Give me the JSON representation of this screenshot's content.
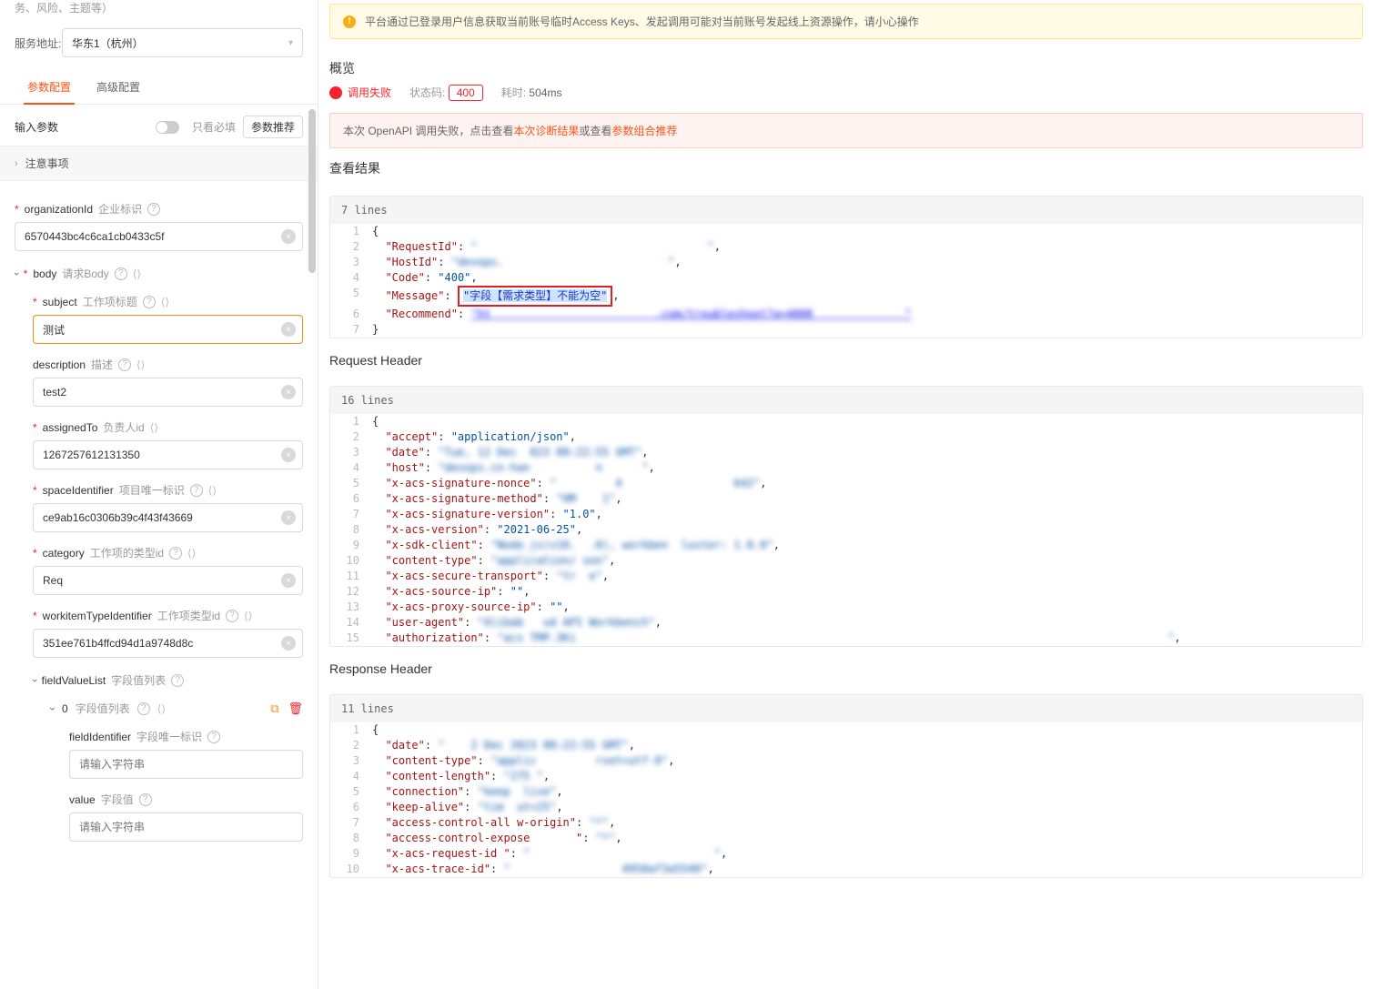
{
  "sidebar": {
    "topNote": "务、风险、主题等）",
    "serviceLabel": "服务地址:",
    "serviceValue": "华东1（杭州）",
    "tabs": {
      "param": "参数配置",
      "adv": "高级配置"
    },
    "inputParamsLabel": "输入参数",
    "onlyRequired": "只看必填",
    "recommend": "参数推荐",
    "notice": "注意事项",
    "fields": {
      "organizationId": {
        "key": "organizationId",
        "hint": "企业标识",
        "value": "6570443bc4c6ca1cb0433c5f"
      },
      "body": {
        "key": "body",
        "hint": "请求Body"
      },
      "subject": {
        "key": "subject",
        "hint": "工作项标题",
        "value": "测试"
      },
      "description": {
        "key": "description",
        "hint": "描述",
        "value": "test2"
      },
      "assignedTo": {
        "key": "assignedTo",
        "hint": "负责人id",
        "value": "1267257612131350"
      },
      "spaceIdentifier": {
        "key": "spaceIdentifier",
        "hint": "项目唯一标识",
        "value": "ce9ab16c0306b39c4f43f43669"
      },
      "category": {
        "key": "category",
        "hint": "工作项的类型id",
        "value": "Req"
      },
      "workitemTypeIdentifier": {
        "key": "workitemTypeIdentifier",
        "hint": "工作项类型id",
        "value": "351ee761b4ffcd94d1a9748d8c"
      },
      "fieldValueList": {
        "key": "fieldValueList",
        "hint": "字段值列表"
      },
      "listItem0": {
        "idx": "0",
        "hint": "字段值列表"
      },
      "fieldIdentifier": {
        "key": "fieldIdentifier",
        "hint": "字段唯一标识",
        "placeholder": "请输入字符串"
      },
      "value": {
        "key": "value",
        "hint": "字段值",
        "placeholder": "请输入字符串"
      }
    }
  },
  "main": {
    "warnText": "平台通过已登录用户信息获取当前账号临时Access Keys、发起调用可能对当前账号发起线上资源操作，请小心操作",
    "overview": "概览",
    "callFail": "调用失败",
    "statusCodeLabel": "状态码:",
    "statusCode": "400",
    "latencyLabel": "耗时:",
    "latency": "504ms",
    "diag": {
      "prefix": "本次 OpenAPI 调用失败，点击查看",
      "link1": "本次诊断结果",
      "mid": "或查看",
      "link2": "参数组合推荐"
    },
    "resultTitle": "查看结果",
    "requestHeaderTitle": "Request Header",
    "responseHeaderTitle": "Response Header",
    "result": {
      "lines": "7 lines",
      "r1": "{",
      "r2a": "\"RequestId\"",
      "r2b": ": ",
      "r2c": "\"                                   \"",
      "r2d": ",",
      "r3a": "\"HostId\"",
      "r3b": ": ",
      "r3c": "\"devops.                         \"",
      "r3d": ",",
      "r4a": "\"Code\"",
      "r4b": ": ",
      "r4c": "\"400\"",
      "r4d": ",",
      "r5a": "\"Message\"",
      "r5b": ": ",
      "r5hl": "\"字段【需求类型】不能为空\"",
      "r5d": ",",
      "r6a": "\"Recommend\"",
      "r6b": ": ",
      "r6c": "\"ht                         .com/troubleshoot?q=4008              \"",
      "r7": "}"
    },
    "reqH": {
      "lines": "16 lines",
      "l1": "{",
      "l2": {
        "k": "\"accept\"",
        "v": "\"application/json\""
      },
      "l3": {
        "k": "\"date\"",
        "v": "\"Tue, 12 Dec  023 08:22:55 GMT\""
      },
      "l4": {
        "k": "\"host\"",
        "v": "\"devops.cn-han          n      \""
      },
      "l5": {
        "k": "\"x-acs-signature-nonce\"",
        "v": "\"         4                 642\""
      },
      "l6": {
        "k": "\"x-acs-signature-method\"",
        "v": "\"HM    1\""
      },
      "l7": {
        "k": "\"x-acs-signature-version\"",
        "v": "\"1.0\""
      },
      "l8": {
        "k": "\"x-acs-version\"",
        "v": "\"2021-06-25\""
      },
      "l9": {
        "k": "\"x-sdk-client\"",
        "v": "\"Node.js(v10.  .0), workben  luster: 1.0.0\""
      },
      "l10": {
        "k": "\"content-type\"",
        "v": "\"application/ son\""
      },
      "l11": {
        "k": "\"x-acs-secure-transport\"",
        "v": "\"tr  e\""
      },
      "l12": {
        "k": "\"x-acs-source-ip\"",
        "v": "\"\""
      },
      "l13": {
        "k": "\"x-acs-proxy-source-ip\"",
        "v": "\"\""
      },
      "l14": {
        "k": "\"user-agent\"",
        "v": "\"Alibab   ud API Workbench\""
      },
      "l15": {
        "k": "\"authorization\"",
        "v": "\"acs TMP.3Ki                                                                                          \""
      }
    },
    "resH": {
      "lines": "11 lines",
      "l1": "{",
      "l2": {
        "k": "\"date\"",
        "v": "\"    2 Dec 2023 08:22:55 GMT\""
      },
      "l3": {
        "k": "\"content-type\"",
        "v": "\"applic         rset=utf-8\""
      },
      "l4": {
        "k": "\"content-length\"",
        "v": "\"275 \""
      },
      "l5": {
        "k": "\"connection\"",
        "v": "\"keep  live\""
      },
      "l6": {
        "k": "\"keep-alive\"",
        "v": "\"tim  ut=25\""
      },
      "l7": {
        "k": "\"access-control-all w-origin\"",
        "v": "\"*\""
      },
      "l8": {
        "k": "\"access-control-expose       \"",
        "v": "\"*\""
      },
      "l9": {
        "k": "\"x-acs-request-id \"",
        "v": "\"                            \""
      },
      "l10": {
        "k": "\"x-acs-trace-id\"",
        "v": "\"                 4958af3a5540\""
      }
    }
  }
}
